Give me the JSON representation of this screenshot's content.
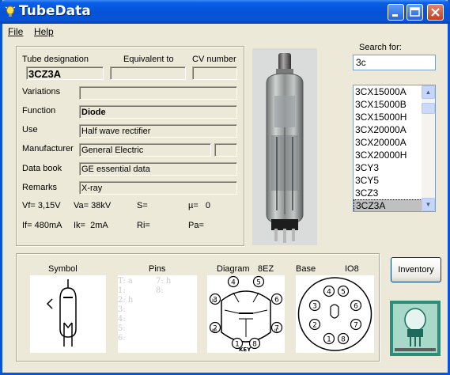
{
  "window": {
    "title": "TubeData",
    "icon": "lightbulb-icon"
  },
  "menu": {
    "file": "File",
    "help": "Help"
  },
  "header": {
    "designation_label": "Tube designation",
    "equivalent_label": "Equivalent to",
    "cv_label": "CV number"
  },
  "tube": {
    "designation": "3CZ3A",
    "equivalent": "",
    "cv_number": "",
    "variations": "",
    "function": "Diode",
    "use": "Half wave rectifier",
    "manufacturer": "General Electric",
    "manufacturer_extra": "",
    "data_book": "GE essential data",
    "remarks": "X-ray"
  },
  "labels": {
    "variations": "Variations",
    "function": "Function",
    "use": "Use",
    "manufacturer": "Manufacturer",
    "data_book": "Data book",
    "remarks": "Remarks"
  },
  "params": {
    "vf": "Vf= 3,15V",
    "va": "Va= 38kV",
    "s": "S=",
    "mu": "µ=   0",
    "if": "If= 480mA",
    "ik": "Ik=  2mA",
    "ri": "Ri=",
    "pa": "Pa="
  },
  "search": {
    "label": "Search for:",
    "value": "3c"
  },
  "results": [
    "3CX15000A",
    "3CX15000B",
    "3CX15000H",
    "3CX20000A",
    "3CX20000A",
    "3CX20000H",
    "3CY3",
    "3CY5",
    "3CZ3",
    "3CZ3A"
  ],
  "selected_result": "3CZ3A",
  "bottom": {
    "symbol_label": "Symbol",
    "pins_label": "Pins",
    "diagram_label": "Diagram",
    "diagram_code": "8EZ",
    "base_label": "Base",
    "base_code": "IO8",
    "pins_col1": "T: a\n1:\n2: h\n3:\n4:\n5:\n6:",
    "pins_col2": "7: h\n8:",
    "inventory_button": "Inventory"
  },
  "diagram_pins": {
    "top": [
      "4",
      "5"
    ],
    "left": [
      "3",
      "2"
    ],
    "right": [
      "6",
      "7"
    ],
    "bottom": [
      "1",
      "8"
    ],
    "ic_labels": [
      "IC",
      "IC",
      "IC"
    ],
    "key": "KEY"
  },
  "base_pins": [
    "1",
    "2",
    "3",
    "4",
    "5",
    "6",
    "7",
    "8"
  ]
}
